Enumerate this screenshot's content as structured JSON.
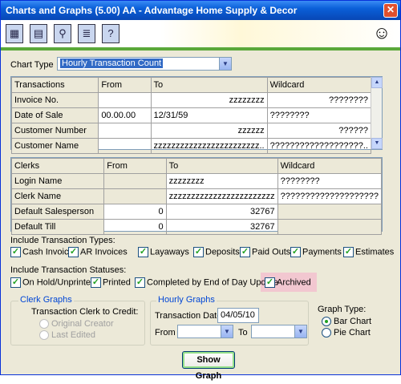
{
  "window": {
    "title": "Charts and Graphs (5.00) AA - Advantage Home Supply & Decor",
    "close_glyph": "✕"
  },
  "toolbar": {
    "icons": [
      {
        "name": "calculator-icon",
        "glyph": "▦"
      },
      {
        "name": "calendar-icon",
        "glyph": "▤"
      },
      {
        "name": "magnifier-icon",
        "glyph": "⚲"
      },
      {
        "name": "notes-icon",
        "glyph": "≣"
      },
      {
        "name": "help-icon",
        "glyph": "?"
      }
    ],
    "mascot_glyph": "☺"
  },
  "chart_type": {
    "label": "Chart Type",
    "value": "Hourly Transaction Count"
  },
  "transactions_grid": {
    "headers": [
      "Transactions",
      "From",
      "To",
      "Wildcard"
    ],
    "rows": [
      [
        "Invoice No.",
        "",
        "zzzzzzzz",
        "????????"
      ],
      [
        "Date of Sale",
        "00.00.00",
        "12/31/59",
        "????????"
      ],
      [
        "Customer Number",
        "",
        "zzzzzz",
        "??????"
      ],
      [
        "Customer Name",
        "",
        "zzzzzzzzzzzzzzzzzzzzzzzz..",
        "???????????????????.."
      ]
    ]
  },
  "clerks_grid": {
    "headers": [
      "Clerks",
      "From",
      "To",
      "Wildcard"
    ],
    "rows": [
      [
        "Login Name",
        "",
        "zzzzzzzz",
        "????????"
      ],
      [
        "Clerk Name",
        "",
        "zzzzzzzzzzzzzzzzzzzzzzzz",
        "????????????????????"
      ],
      [
        "Default Salesperson",
        "0",
        "32767",
        ""
      ],
      [
        "Default Till",
        "0",
        "32767",
        ""
      ]
    ]
  },
  "transaction_types": {
    "label": "Include Transaction Types:",
    "items": [
      {
        "label": "Cash Invoices",
        "checked": true
      },
      {
        "label": "AR Invoices",
        "checked": true
      },
      {
        "label": "Layaways",
        "checked": true
      },
      {
        "label": "Deposits",
        "checked": true
      },
      {
        "label": "Paid Outs",
        "checked": true
      },
      {
        "label": "Payments",
        "checked": true
      },
      {
        "label": "Estimates",
        "checked": true
      }
    ]
  },
  "transaction_statuses": {
    "label": "Include Transaction Statuses:",
    "items": [
      {
        "label": "On Hold/Unprinted",
        "checked": true
      },
      {
        "label": "Printed",
        "checked": true
      },
      {
        "label": "Completed by End of Day Update",
        "checked": true
      },
      {
        "label": "Archived",
        "checked": true
      }
    ]
  },
  "clerk_graphs": {
    "title": "Clerk Graphs",
    "subtitle": "Transaction Clerk to Credit:",
    "options": [
      "Original Creator",
      "Last Edited"
    ]
  },
  "hourly_graphs": {
    "title": "Hourly Graphs",
    "date_label": "Transaction Date",
    "date_value": "04/05/10",
    "from_label": "From",
    "to_label": "To"
  },
  "graph_type": {
    "label": "Graph Type:",
    "options": [
      {
        "label": "Bar Chart",
        "selected": true
      },
      {
        "label": "Pie Chart",
        "selected": false
      }
    ]
  },
  "show_graph_label": "Show Graph",
  "check_glyph": "✓",
  "arrow_down": "▼",
  "arrow_up": "▲"
}
